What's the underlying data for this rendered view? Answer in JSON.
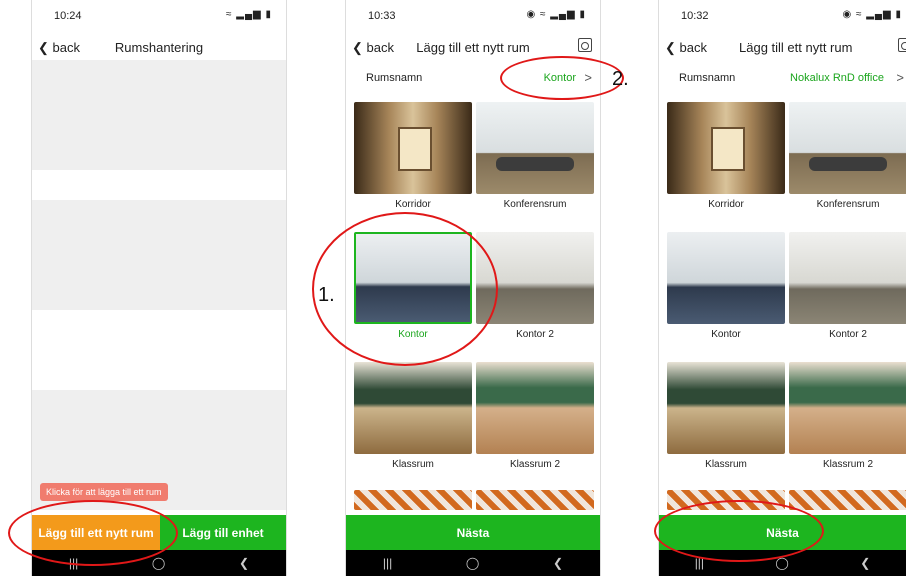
{
  "screen1": {
    "time": "10:24",
    "status_icons": "≈ ▂▄▆ ▮",
    "back": "❮ back",
    "title": "Rumshantering",
    "tooltip": "Klicka för att lägga till ett rum",
    "add_room": "Lägg till ett nytt rum",
    "add_device": "Lägg till enhet"
  },
  "screen2": {
    "time": "10:33",
    "status_icons": "◉ ≈ ▂▄▆ ▮",
    "back": "❮ back",
    "title": "Lägg till ett nytt rum",
    "name_label": "Rumsnamn",
    "name_value": "Kontor",
    "tiles": [
      "Korridor",
      "Konferensrum",
      "Kontor",
      "Kontor 2",
      "Klassrum",
      "Klassrum 2"
    ],
    "next": "Nästa"
  },
  "screen3": {
    "time": "10:32",
    "status_icons": "◉ ≈ ▂▄▆ ▮",
    "back": "❮ back",
    "title": "Lägg till ett nytt rum",
    "name_label": "Rumsnamn",
    "name_value": "Nokalux RnD office",
    "tiles": [
      "Korridor",
      "Konferensrum",
      "Kontor",
      "Kontor 2",
      "Klassrum",
      "Klassrum 2"
    ],
    "next": "Nästa"
  },
  "nav": {
    "recent": "|||",
    "home": "◯",
    "back": "❮"
  },
  "annotations": {
    "step1": "1.",
    "step2": "2."
  },
  "colors": {
    "green": "#1db51f",
    "orange": "#f39a1b",
    "tooltip": "#f07c6e",
    "highlight": "#e01818"
  }
}
